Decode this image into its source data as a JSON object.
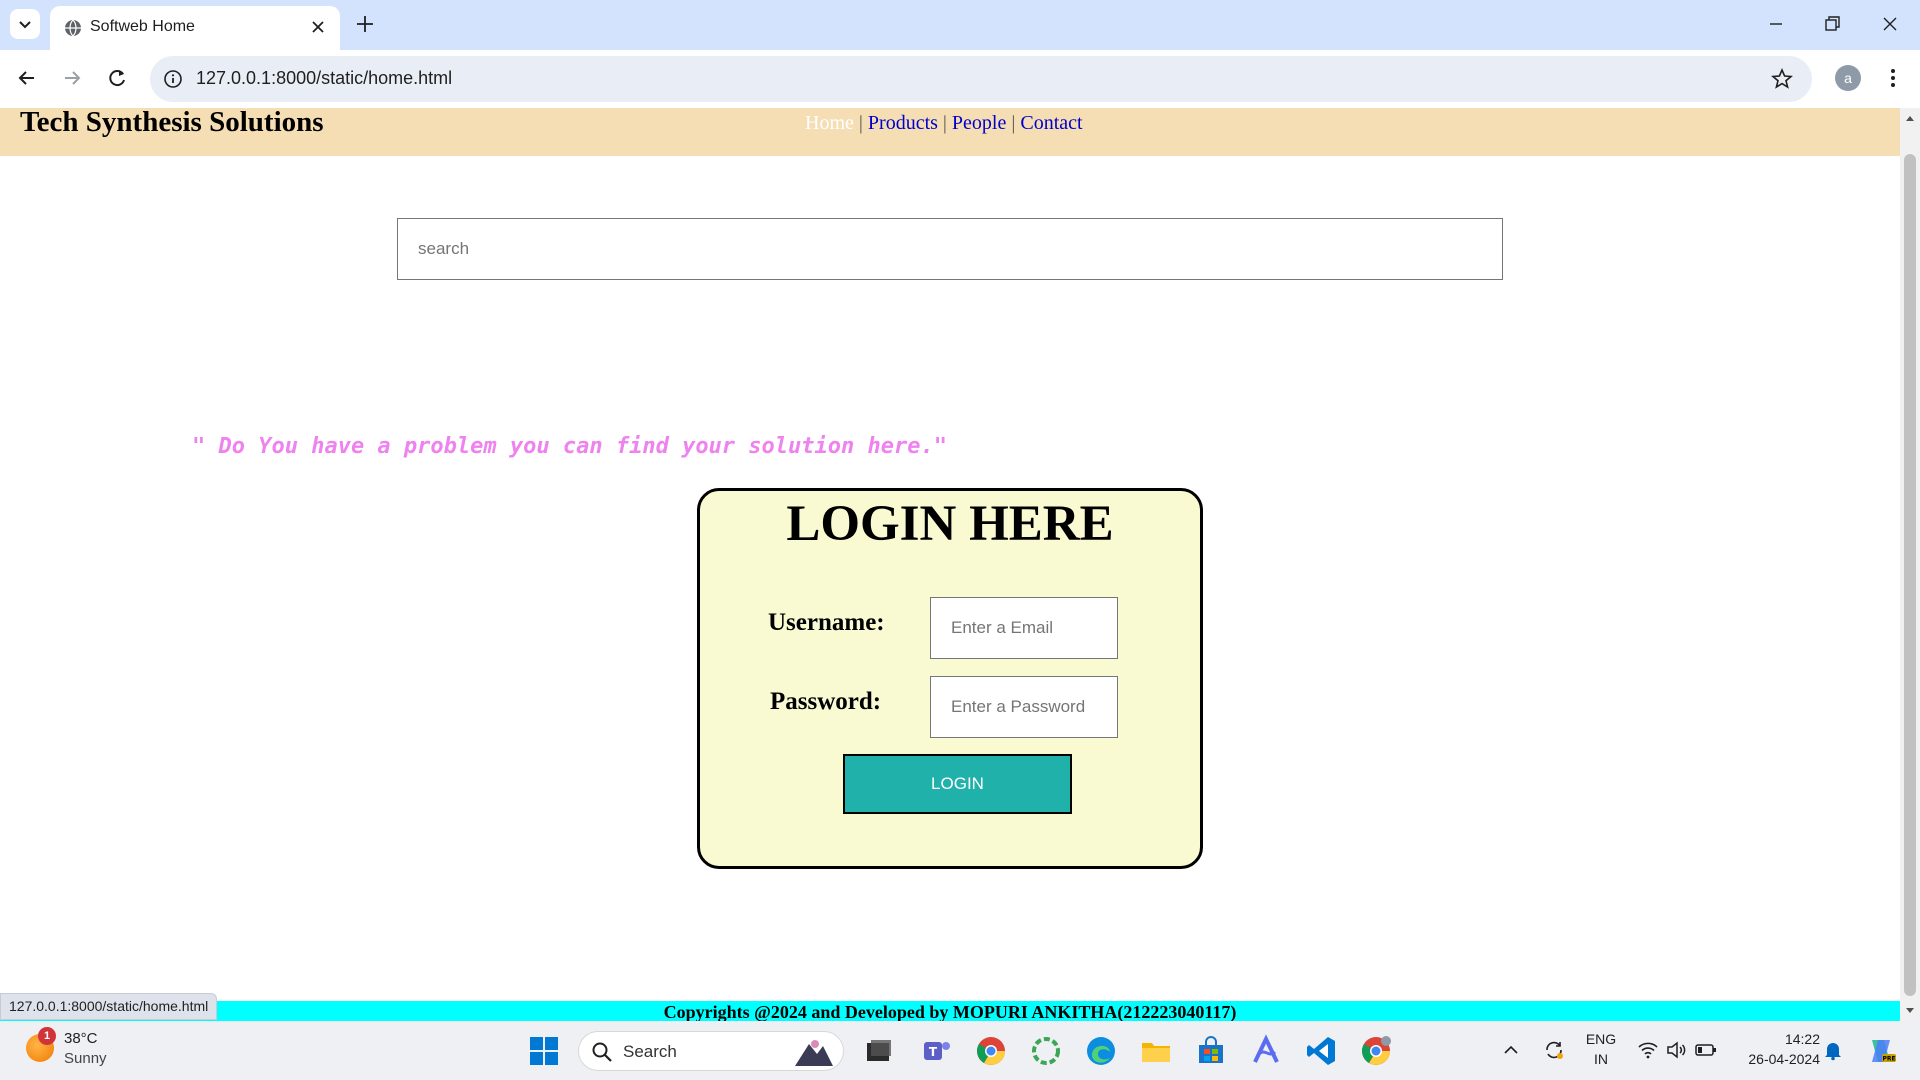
{
  "browser": {
    "tab_title": "Softweb Home",
    "url": "127.0.0.1:8000/static/home.html",
    "profile_initial": "a",
    "status_url": "127.0.0.1:8000/static/home.html"
  },
  "site": {
    "title": "Tech Synthesis Solutions",
    "nav": [
      {
        "label": "Home",
        "active": true
      },
      {
        "label": "Products",
        "active": false
      },
      {
        "label": "People",
        "active": false
      },
      {
        "label": "Contact",
        "active": false
      }
    ],
    "nav_separator": "|",
    "search_placeholder": "search",
    "quote": "\" Do You have a problem you can find your solution here.\"",
    "login": {
      "title": "LOGIN HERE",
      "username_label": "Username:",
      "username_placeholder": "Enter a Email",
      "password_label": "Password:",
      "password_placeholder": "Enter a Password",
      "button_label": "LOGIN"
    },
    "footer": "Copyrights @2024 and Developed by MOPURI ANKITHA(212223040117)"
  },
  "colors": {
    "header_bg": "#f5deb3",
    "card_bg": "#fafad2",
    "button_bg": "#20b2aa",
    "footer_bg": "#00ffff",
    "quote_color": "#ee82ee",
    "nav_link": "#0000cc"
  },
  "taskbar": {
    "weather_temp": "38°C",
    "weather_condition": "Sunny",
    "weather_badge": "1",
    "search_label": "Search",
    "apps": [
      "files-icon",
      "teams-icon",
      "chrome-icon",
      "circle-app-icon",
      "edge-icon",
      "file-explorer-icon",
      "store-icon",
      "arc-icon",
      "vscode-icon",
      "chrome-profile-icon"
    ],
    "lang_line1": "ENG",
    "lang_line2": "IN",
    "time": "14:22",
    "date": "26-04-2024"
  }
}
